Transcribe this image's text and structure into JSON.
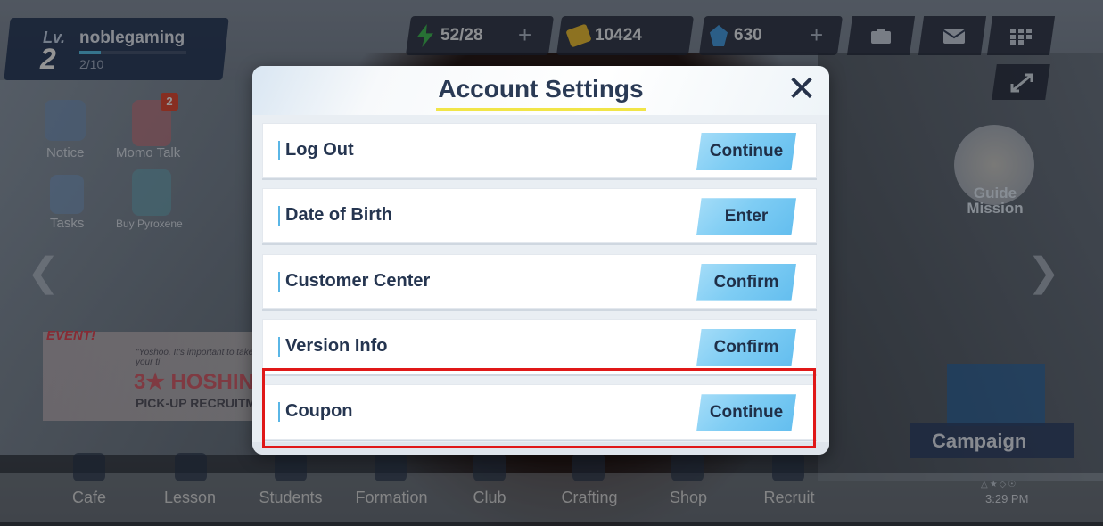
{
  "player": {
    "level_label": "Lv.",
    "level": "2",
    "name": "noblegaming",
    "exp_text": "2/10",
    "exp_fraction": 0.2
  },
  "resources": {
    "ap": "52/28",
    "credits": "10424",
    "pyroxene": "630",
    "plus": "+"
  },
  "side": {
    "notice": "Notice",
    "momo_talk": "Momo Talk",
    "momo_badge": "2",
    "tasks": "Tasks",
    "buy_pyroxene": "Buy Pyroxene"
  },
  "event": {
    "tag": "EVENT!",
    "line": "\"Yoshoo. It's important to take your ti",
    "big": "3★ HOSHIN",
    "small": "PICK-UP RECRUITME"
  },
  "guide": {
    "label_1": "Guide",
    "label_2": "Mission"
  },
  "campaign": "Campaign",
  "nav": [
    "Cafe",
    "Lesson",
    "Students",
    "Formation",
    "Club",
    "Crafting",
    "Shop",
    "Recruit"
  ],
  "clock": "3:29 PM",
  "clock_icons": "△★◇☉",
  "modal": {
    "title": "Account Settings",
    "close_glyph": "✕",
    "rows": [
      {
        "label": "Log Out",
        "button": "Continue"
      },
      {
        "label": "Date of Birth",
        "button": "Enter"
      },
      {
        "label": "Customer Center",
        "button": "Confirm"
      },
      {
        "label": "Version Info",
        "button": "Confirm"
      },
      {
        "label": "Coupon",
        "button": "Continue"
      }
    ]
  },
  "arrows": {
    "left": "❮",
    "right": "❯"
  },
  "colors": {
    "accent_button": "#7fcdf4",
    "title_text": "#2a3a55",
    "highlight": "#e01818",
    "underline": "#f1e548"
  }
}
